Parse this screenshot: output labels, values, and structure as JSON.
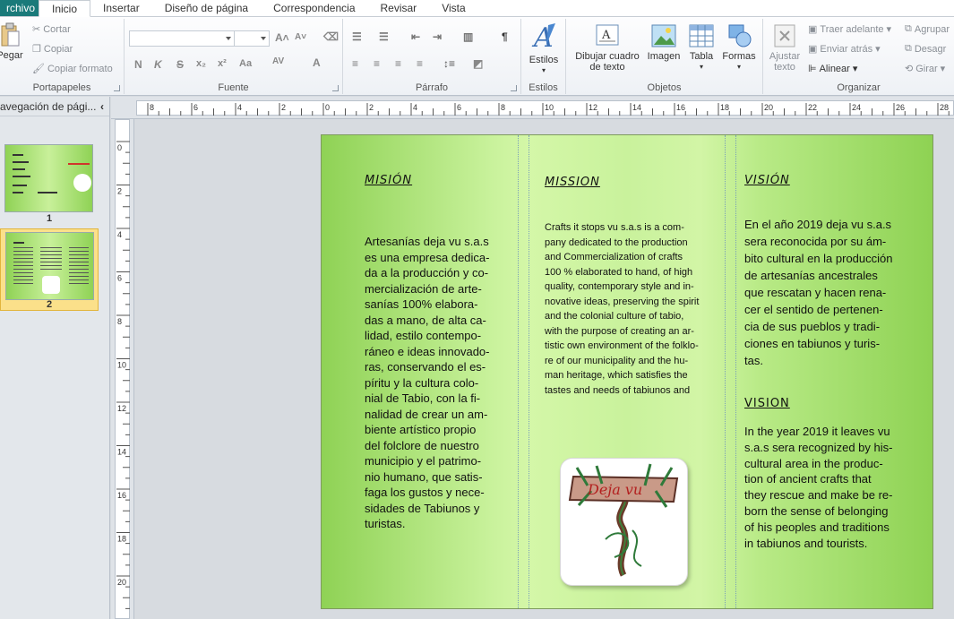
{
  "tabs": {
    "file": "rchivo",
    "items": [
      "Inicio",
      "Insertar",
      "Diseño de página",
      "Correspondencia",
      "Revisar",
      "Vista"
    ],
    "active": "Inicio"
  },
  "ribbon": {
    "clipboard": {
      "paste": "Pegar",
      "cut": "Cortar",
      "copy": "Copiar",
      "format_painter": "Copiar formato",
      "label": "Portapapeles"
    },
    "font": {
      "label": "Fuente",
      "bold": "N",
      "italic": "K",
      "strike": "S",
      "change_case": "Aa"
    },
    "paragraph": {
      "label": "Párrafo",
      "pilcrow": "¶"
    },
    "styles": {
      "button": "Estilos",
      "label": "Estilos"
    },
    "objects": {
      "draw_textbox": "Dibujar cuadro de texto",
      "image": "Imagen",
      "table": "Tabla",
      "shapes": "Formas",
      "label": "Objetos"
    },
    "arrange": {
      "wrap_text": "Ajustar texto",
      "bring_forward": "Traer adelante",
      "send_backward": "Enviar atrás",
      "align": "Alinear",
      "group": "Agrupar",
      "ungroup": "Desagr",
      "rotate": "Girar",
      "label": "Organizar"
    }
  },
  "nav": {
    "title": "avegación de pági...",
    "pages": [
      {
        "number": "1"
      },
      {
        "number": "2"
      }
    ],
    "selected": "2"
  },
  "ruler": {
    "h_labels": [
      "8",
      "6",
      "4",
      "2",
      "0",
      "2",
      "4",
      "6",
      "8",
      "10",
      "12",
      "14",
      "16",
      "18",
      "20",
      "22",
      "24",
      "26",
      "28"
    ],
    "v_labels": [
      "0",
      "2",
      "4",
      "6",
      "8",
      "10",
      "12",
      "14",
      "16",
      "18",
      "20"
    ]
  },
  "document": {
    "col1": {
      "heading": "MISIÓN",
      "text": "Artesanías deja vu s.a.s\nes una empresa dedica-\nda a la producción y co-\nmercialización de arte-\nsanías 100% elabora-\ndas a mano, de alta ca-\nlidad, estilo contempo-\nráneo e ideas innovado-\nras, conservando el es-\npíritu y la cultura colo-\nnial de Tabio, con la fi-\nnalidad de crear un am-\nbiente artístico propio\ndel folclore de nuestro\nmunicipio y el patrimo-\nnio humano, que satis-\nfaga los gustos y nece-\nsidades de Tabiunos y\nturistas."
    },
    "col2": {
      "heading": "MISSION",
      "text": "Crafts it stops vu s.a.s is a com-\npany dedicated to the production\nand Commercialization of crafts\n100 % elaborated to hand, of high\nquality, contemporary style and in-\nnovative ideas, preserving the spirit\nand the colonial culture of tabio,\nwith the purpose of creating an ar-\ntistic own environment of the folklo-\nre of our municipality and the hu-\nman heritage, which satisfies the\ntastes and needs of tabiunos and"
    },
    "col3": {
      "heading_es": "VISIÓN",
      "text_es": "En el año 2019 deja vu s.a.s\nsera reconocida por su ám-\nbito cultural en la producción\nde artesanías ancestrales\nque rescatan y hacen rena-\ncer el sentido de pertenen-\ncia de sus pueblos y tradi-\nciones en tabiunos y turis-\ntas.",
      "heading_en": "VISION",
      "text_en": " In the year 2019 it leaves vu\ns.a.s sera recognized by his-\ncultural area in the produc-\ntion of ancient crafts that\nthey rescue and make be re-\nborn the sense of belonging\nof his peoples  and traditions\nin tabiunos and tourists."
    },
    "logo_icon": "deja-vu-logo"
  },
  "colors": {
    "file_tab": "#1a7a7a",
    "page_green_dark": "#8fd255",
    "page_green_light": "#d4f7a8",
    "nav_selected": "#fbe08a"
  }
}
